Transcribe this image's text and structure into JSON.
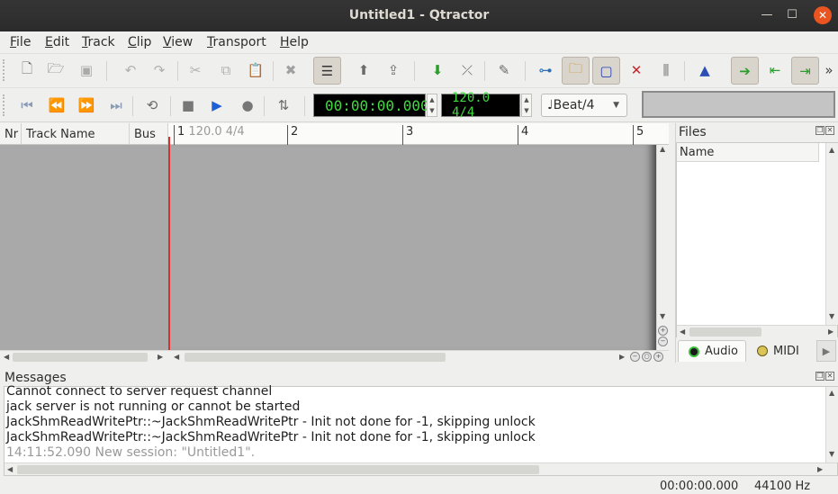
{
  "window": {
    "title": "Untitled1 - Qtractor",
    "minimize_glyph": "—",
    "maximize_glyph": "☐",
    "close_glyph": "✕"
  },
  "menubar": {
    "items": [
      "File",
      "Edit",
      "Track",
      "Clip",
      "View",
      "Transport",
      "Help"
    ],
    "underlined": [
      "F",
      "E",
      "T",
      "C",
      "V",
      "T",
      "H"
    ]
  },
  "toolbar_main": {
    "icons": [
      "new-icon",
      "open-icon",
      "save-icon",
      "undo-icon",
      "redo-icon",
      "cut-icon",
      "copy-icon",
      "paste-icon",
      "delete-icon",
      "select-mode-icon",
      "add-track-icon",
      "track-properties-icon",
      "import-icon",
      "remove-track-icon",
      "edit-clip-icon",
      "connections-icon",
      "files-icon",
      "mixer-icon",
      "cross-icon",
      "plugins-icon",
      "metronome-icon",
      "follow-playhead-icon",
      "set-left-icon",
      "set-right-icon"
    ],
    "overflow": "»"
  },
  "transport": {
    "icons": [
      "backward-start-icon",
      "rewind-icon",
      "fast-forward-icon",
      "forward-end-icon",
      "loop-icon",
      "stop-icon",
      "play-icon",
      "record-icon",
      "punch-icon"
    ],
    "time": "00:00:00.000",
    "tempo": "120.0 4/4",
    "snap": "Beat/4",
    "snap_note_glyph": "♩"
  },
  "tracks": {
    "headers": [
      "Nr",
      "Track Name",
      "Bus"
    ]
  },
  "ruler": {
    "bars": [
      "1",
      "2",
      "3",
      "4",
      "5"
    ],
    "first_meta": "120.0 4/4"
  },
  "files_panel": {
    "title": "Files",
    "column": "Name",
    "tabs": [
      "Audio",
      "MIDI"
    ],
    "tab_arrow": "▶"
  },
  "messages_panel": {
    "title": "Messages",
    "lines": [
      "Cannot connect to server request channel",
      "jack server is not running or cannot be started",
      "JackShmReadWritePtr::~JackShmReadWritePtr - Init not done for -1, skipping unlock",
      "JackShmReadWritePtr::~JackShmReadWritePtr - Init not done for -1, skipping unlock",
      "14:11:52.090 New session: \"Untitled1\"."
    ]
  },
  "statusbar": {
    "time": "00:00:00.000",
    "sample_rate": "44100 Hz"
  },
  "colors": {
    "lcd_green": "#43d943",
    "accent_close": "#e95420",
    "playhead": "#d8302f"
  }
}
